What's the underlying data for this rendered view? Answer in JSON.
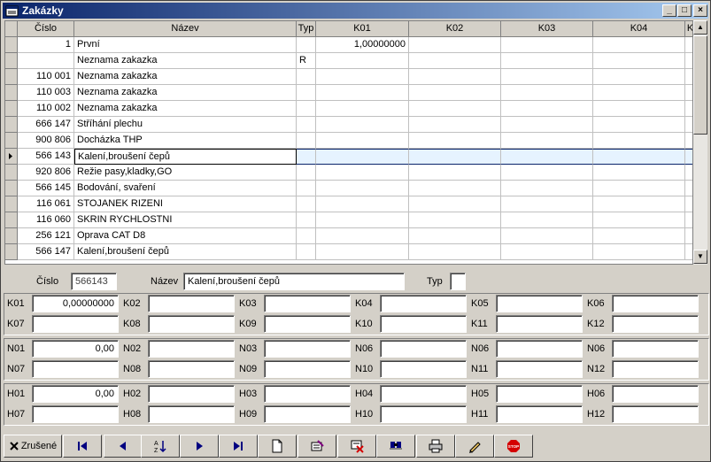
{
  "window": {
    "title": "Zakázky",
    "minimize": "_",
    "maximize": "□",
    "close": "×"
  },
  "grid": {
    "columns": [
      "Číslo",
      "Název",
      "Typ",
      "K01",
      "K02",
      "K03",
      "K04",
      "K"
    ],
    "rows": [
      {
        "cislo": "1",
        "nazev": "První",
        "typ": "",
        "k01": "1,00000000"
      },
      {
        "cislo": "",
        "nazev": "Neznama zakazka",
        "typ": "R",
        "k01": ""
      },
      {
        "cislo": "110 001",
        "nazev": "Neznama zakazka",
        "typ": "",
        "k01": ""
      },
      {
        "cislo": "110 003",
        "nazev": "Neznama zakazka",
        "typ": "",
        "k01": ""
      },
      {
        "cislo": "110 002",
        "nazev": "Neznama zakazka",
        "typ": "",
        "k01": ""
      },
      {
        "cislo": "666 147",
        "nazev": "Stříhání plechu",
        "typ": "",
        "k01": ""
      },
      {
        "cislo": "900 806",
        "nazev": "Docházka THP",
        "typ": "",
        "k01": ""
      },
      {
        "cislo": "566 143",
        "nazev": "Kalení,broušení čepů",
        "typ": "",
        "k01": "",
        "selected": true
      },
      {
        "cislo": "920 806",
        "nazev": "Režie pasy,kladky,GO",
        "typ": "",
        "k01": ""
      },
      {
        "cislo": "566 145",
        "nazev": "Bodování, svaření",
        "typ": "",
        "k01": ""
      },
      {
        "cislo": "116 061",
        "nazev": "STOJANEK RIZENI",
        "typ": "",
        "k01": ""
      },
      {
        "cislo": "116 060",
        "nazev": "SKRIN RYCHLOSTNI",
        "typ": "",
        "k01": ""
      },
      {
        "cislo": "256 121",
        "nazev": "Oprava CAT D8",
        "typ": "",
        "k01": ""
      },
      {
        "cislo": "566 147",
        "nazev": "Kalení,broušení čepů",
        "typ": "",
        "k01": ""
      }
    ]
  },
  "form": {
    "cislo_label": "Číslo",
    "cislo_value": "566143",
    "nazev_label": "Název",
    "nazev_value": "Kalení,broušení čepů",
    "typ_label": "Typ",
    "typ_value": "",
    "groups": [
      {
        "rows": [
          [
            {
              "label": "K01",
              "value": "0,00000000"
            },
            {
              "label": "K02",
              "value": ""
            },
            {
              "label": "K03",
              "value": ""
            },
            {
              "label": "K04",
              "value": ""
            },
            {
              "label": "K05",
              "value": ""
            },
            {
              "label": "K06",
              "value": ""
            }
          ],
          [
            {
              "label": "K07",
              "value": ""
            },
            {
              "label": "K08",
              "value": ""
            },
            {
              "label": "K09",
              "value": ""
            },
            {
              "label": "K10",
              "value": ""
            },
            {
              "label": "K11",
              "value": ""
            },
            {
              "label": "K12",
              "value": ""
            }
          ]
        ]
      },
      {
        "rows": [
          [
            {
              "label": "N01",
              "value": "0,00"
            },
            {
              "label": "N02",
              "value": ""
            },
            {
              "label": "N03",
              "value": ""
            },
            {
              "label": "N06",
              "value": ""
            },
            {
              "label": "N06",
              "value": ""
            },
            {
              "label": "N06",
              "value": ""
            }
          ],
          [
            {
              "label": "N07",
              "value": ""
            },
            {
              "label": "N08",
              "value": ""
            },
            {
              "label": "N09",
              "value": ""
            },
            {
              "label": "N10",
              "value": ""
            },
            {
              "label": "N11",
              "value": ""
            },
            {
              "label": "N12",
              "value": ""
            }
          ]
        ]
      },
      {
        "rows": [
          [
            {
              "label": "H01",
              "value": "0,00"
            },
            {
              "label": "H02",
              "value": ""
            },
            {
              "label": "H03",
              "value": ""
            },
            {
              "label": "H04",
              "value": ""
            },
            {
              "label": "H05",
              "value": ""
            },
            {
              "label": "H06",
              "value": ""
            }
          ],
          [
            {
              "label": "H07",
              "value": ""
            },
            {
              "label": "H08",
              "value": ""
            },
            {
              "label": "H09",
              "value": ""
            },
            {
              "label": "H10",
              "value": ""
            },
            {
              "label": "H11",
              "value": ""
            },
            {
              "label": "H12",
              "value": ""
            }
          ]
        ]
      }
    ]
  },
  "toolbar": {
    "zrusene_label": "Zrušené",
    "buttons": [
      "first-record-icon",
      "previous-record-icon",
      "sort-az-icon",
      "next-record-icon",
      "last-record-icon",
      "new-document-icon",
      "edit-icon",
      "delete-record-icon",
      "find-icon",
      "print-icon",
      "pencil-icon",
      "stop-icon"
    ]
  },
  "colors": {
    "title_start": "#0a246a",
    "title_end": "#a6caf0",
    "face": "#d4d0c8",
    "selected_row": "#e6f3ff",
    "stop": "#d40000"
  }
}
